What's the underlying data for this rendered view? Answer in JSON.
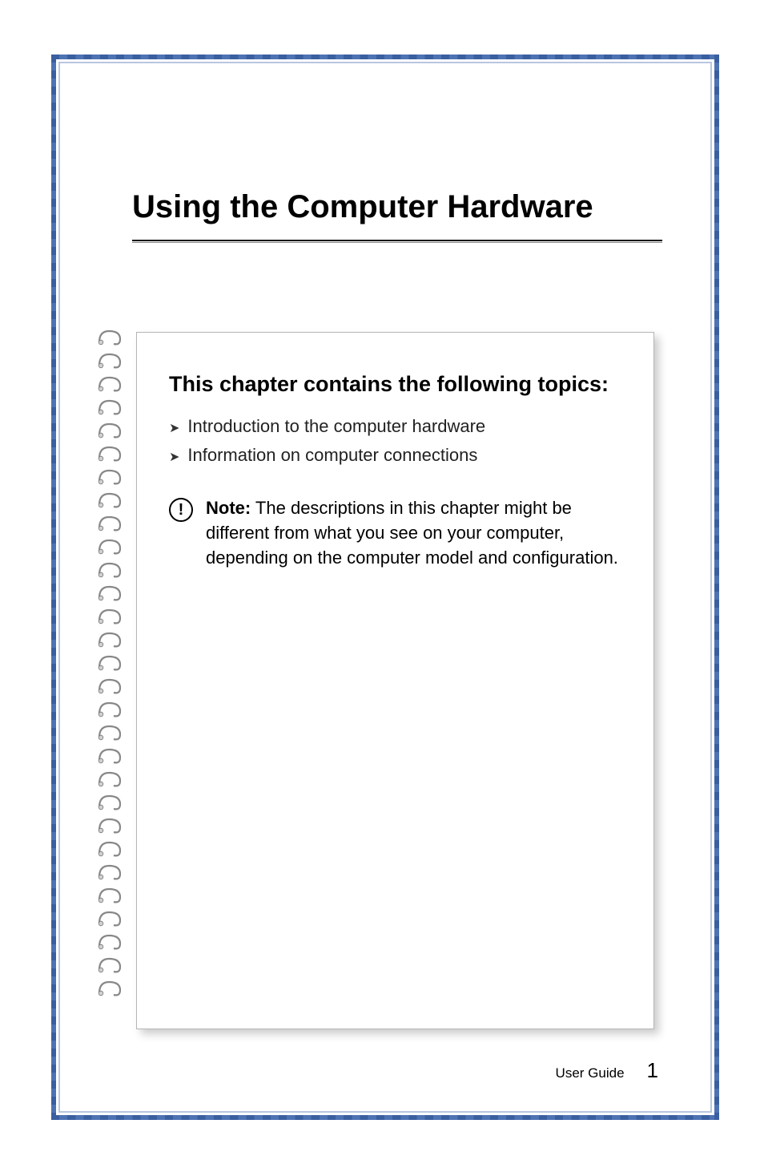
{
  "chapter": {
    "title": "Using the Computer Hardware"
  },
  "section": {
    "heading": "This chapter contains the following topics:",
    "bullets": [
      "Introduction to the computer hardware",
      "Information on computer connections"
    ]
  },
  "note": {
    "label": "Note:",
    "text": " The descriptions in this chapter might be different from what you see on your computer, depending on the computer model and configuration."
  },
  "footer": {
    "label": "User Guide",
    "page": "1"
  },
  "spiral_count": 29
}
